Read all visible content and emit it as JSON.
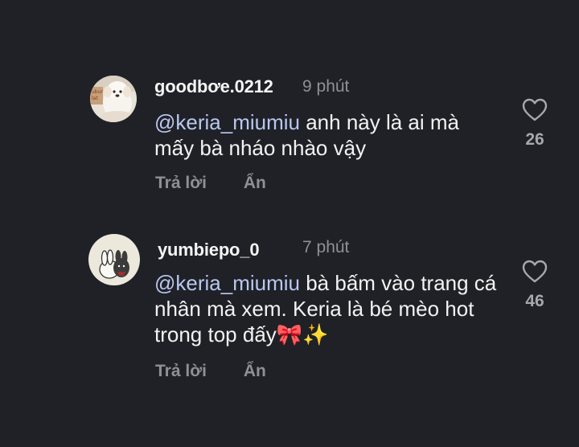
{
  "comments": [
    {
      "username": "goodbơe.0212",
      "time": "9 phút",
      "mention": "@keria_miumiu",
      "text": " anh này là ai mà mấy bà nháo nhào vậy",
      "likes": "26",
      "reply_label": "Trả lời",
      "hide_label": "Ẩn",
      "avatar": "dog-avatar"
    },
    {
      "username": "yumbiepo_0",
      "time": "7 phút",
      "mention": "@keria_miumiu",
      "text": " bà bấm vào trang cá nhân mà xem. Keria là bé mèo hot trong top đấy🎀✨",
      "likes": "46",
      "reply_label": "Trả lời",
      "hide_label": "Ẩn",
      "avatar": "bunny-avatar"
    }
  ],
  "colors": {
    "background": "#1f2127",
    "text": "#f2f2f2",
    "muted": "#8e9097",
    "mention": "#b9c7ef"
  },
  "icons": {
    "like": "heart-outline-icon"
  }
}
